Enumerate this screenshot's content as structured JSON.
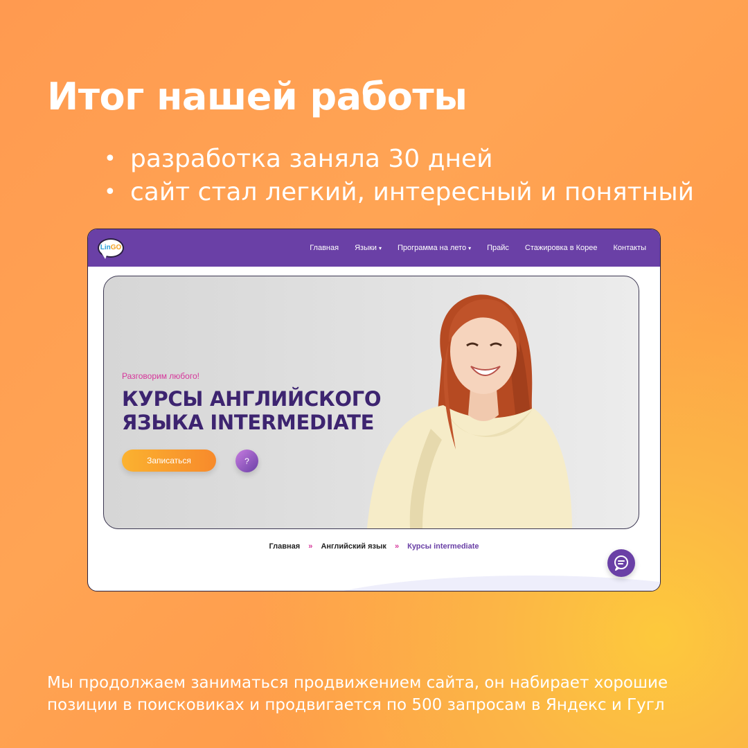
{
  "slide": {
    "title": "Итог нашей работы",
    "bullets": [
      "разработка заняла 30 дней",
      "сайт стал легкий, интересный и понятный"
    ],
    "bullet_glyph": "•",
    "footer_text": "Мы продолжаем заниматься продвижением сайта, он набирает хорошие позиции в поисковиках и продвигается по 500 запросам  в Яндекс и Гугл"
  },
  "site": {
    "logo": {
      "part1": "Lin",
      "part2": "GO"
    },
    "nav": [
      {
        "label": "Главная"
      },
      {
        "label": "Языки",
        "caret": "▾"
      },
      {
        "label": "Программа на лето",
        "caret": "▾"
      },
      {
        "label": "Прайс"
      },
      {
        "label": "Стажировка в Корее"
      },
      {
        "label": "Контакты"
      }
    ],
    "hero": {
      "eyebrow": "Разговорим любого!",
      "title_line1": "КУРСЫ АНГЛИЙСКОГО",
      "title_line2": "ЯЗЫКА INTERMEDIATE",
      "cta_label": "Записаться",
      "help_label": "?"
    },
    "breadcrumb": {
      "items": [
        "Главная",
        "Английский язык"
      ],
      "current": "Курсы intermediate",
      "separator": "»"
    },
    "chat_icon": "chat-bubble-icon"
  },
  "colors": {
    "background": "#ff9f4e",
    "nav": "#6a40a6",
    "hero_title": "#3d2470",
    "eyebrow": "#d6359a",
    "cta": "#f89a2c"
  }
}
